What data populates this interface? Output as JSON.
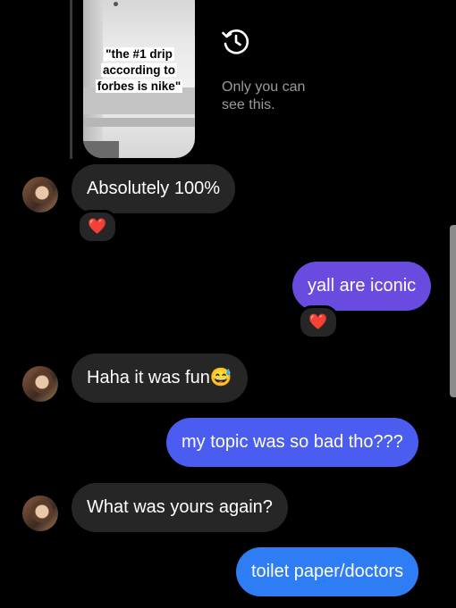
{
  "story_reply": {
    "caption": "\"the #1 drip according to forbes is nike\"",
    "notice": "Only you can\nsee this."
  },
  "messages": [
    {
      "from": "them",
      "text": "Absolutely 100%",
      "reaction": "❤️"
    },
    {
      "from": "me",
      "text": "yall are iconic",
      "reaction": "❤️"
    },
    {
      "from": "them",
      "text": "Haha it was fun😅"
    },
    {
      "from": "me",
      "text": "my topic was so bad tho???"
    },
    {
      "from": "them",
      "text": "What was yours again?"
    },
    {
      "from": "me",
      "text": "toilet paper/doctors"
    }
  ],
  "icons": {
    "timer": "history-clock-icon",
    "reaction": "heart-icon"
  },
  "colors": {
    "background": "#000000",
    "incoming_bubble": "#262626",
    "outgoing_purple": "#6a4be0",
    "outgoing_blue": "#2f7df5",
    "heart": "#ff2d3f",
    "muted_text": "#9a9a9a"
  }
}
